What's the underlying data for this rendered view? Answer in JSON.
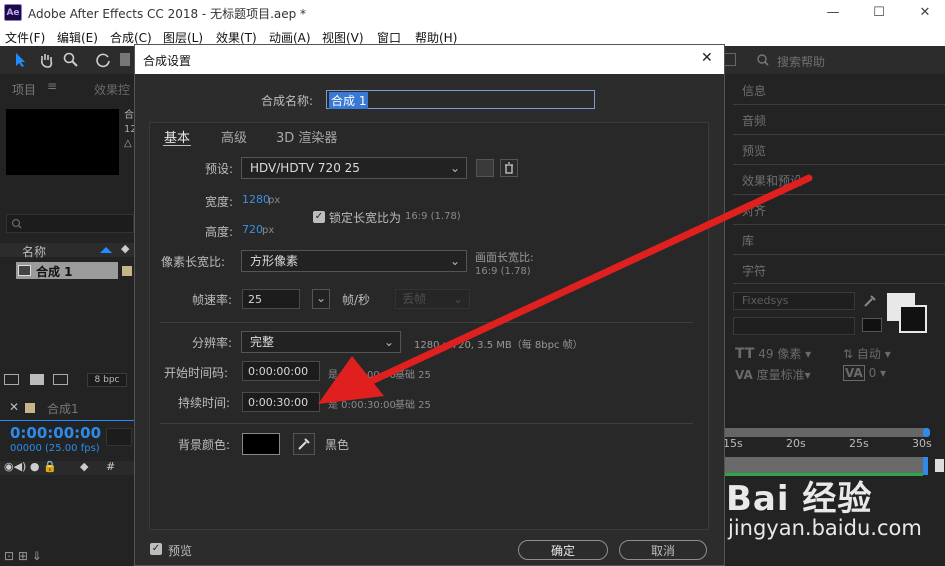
{
  "window": {
    "app_icon": "Ae",
    "title": "Adobe After Effects CC 2018 - 无标题项目.aep *",
    "minimize": "—",
    "maximize": "☐",
    "close": "✕"
  },
  "menubar": [
    "文件(F)",
    "编辑(E)",
    "合成(C)",
    "图层(L)",
    "效果(T)",
    "动画(A)",
    "视图(V)",
    "窗口",
    "帮助(H)"
  ],
  "toolbar": {
    "search_placeholder": "搜索帮助"
  },
  "project_panel": {
    "tab_project": "项目",
    "tab_effects": "效果控",
    "thumb_info": [
      "合",
      "12",
      "△"
    ],
    "column_name": "名称",
    "item_name": "合成 1",
    "bpc": "8 bpc"
  },
  "timeline_panel": {
    "tab": "合成1",
    "timecode": "0:00:00:00",
    "fps_info": "00000 (25.00 fps)",
    "ruler": [
      "15s",
      "20s",
      "25s",
      "30s"
    ]
  },
  "right_panel": {
    "items": [
      "信息",
      "音频",
      "预览",
      "效果和预设",
      "对齐",
      "库",
      "字符"
    ],
    "font": "Fixedsys",
    "size_label": "49 像素",
    "auto_label": "自动",
    "kerning_label": "度量标准",
    "tracking_value": "0"
  },
  "dialog": {
    "title": "合成设置",
    "close": "✕",
    "name_label": "合成名称:",
    "name_value": "合成 1",
    "tabs": [
      "基本",
      "高级",
      "3D 渲染器"
    ],
    "preset_label": "预设:",
    "preset_value": "HDV/HDTV 720 25",
    "width_label": "宽度:",
    "width_value": "1280",
    "width_unit": "px",
    "height_label": "高度:",
    "height_value": "720",
    "height_unit": "px",
    "lock_label": "锁定长宽比为",
    "lock_ratio": "16:9 (1.78)",
    "pixel_aspect_label": "像素长宽比:",
    "pixel_aspect_value": "方形像素",
    "frame_aspect_label": "画面长宽比:",
    "frame_aspect_value": "16:9 (1.78)",
    "framerate_label": "帧速率:",
    "framerate_value": "25",
    "framerate_unit": "帧/秒",
    "drop_frame": "丢帧",
    "resolution_label": "分辨率:",
    "resolution_value": "完整",
    "resolution_info": "1280 x 720, 3.5 MB（每 8bpc 帧）",
    "start_tc_label": "开始时间码:",
    "start_tc_value": "0:00:00:00",
    "start_tc_note": "是 0:00:00:00",
    "start_tc_base": "基础 25",
    "duration_label": "持续时间:",
    "duration_value": "0:00:30:00",
    "duration_note": "是 0:00:30:00",
    "duration_base": "基础 25",
    "bg_color_label": "背景颜色:",
    "bg_color_name": "黑色",
    "preview_label": "预览",
    "ok_button": "确定",
    "cancel_button": "取消"
  },
  "watermark": {
    "logo": "Bai 经验",
    "url": "jingyan.baidu.com"
  },
  "colors": {
    "accent_blue": "#3f8fe0",
    "arrow_red": "#e0201f",
    "timecode_blue": "#2d8ceb"
  }
}
